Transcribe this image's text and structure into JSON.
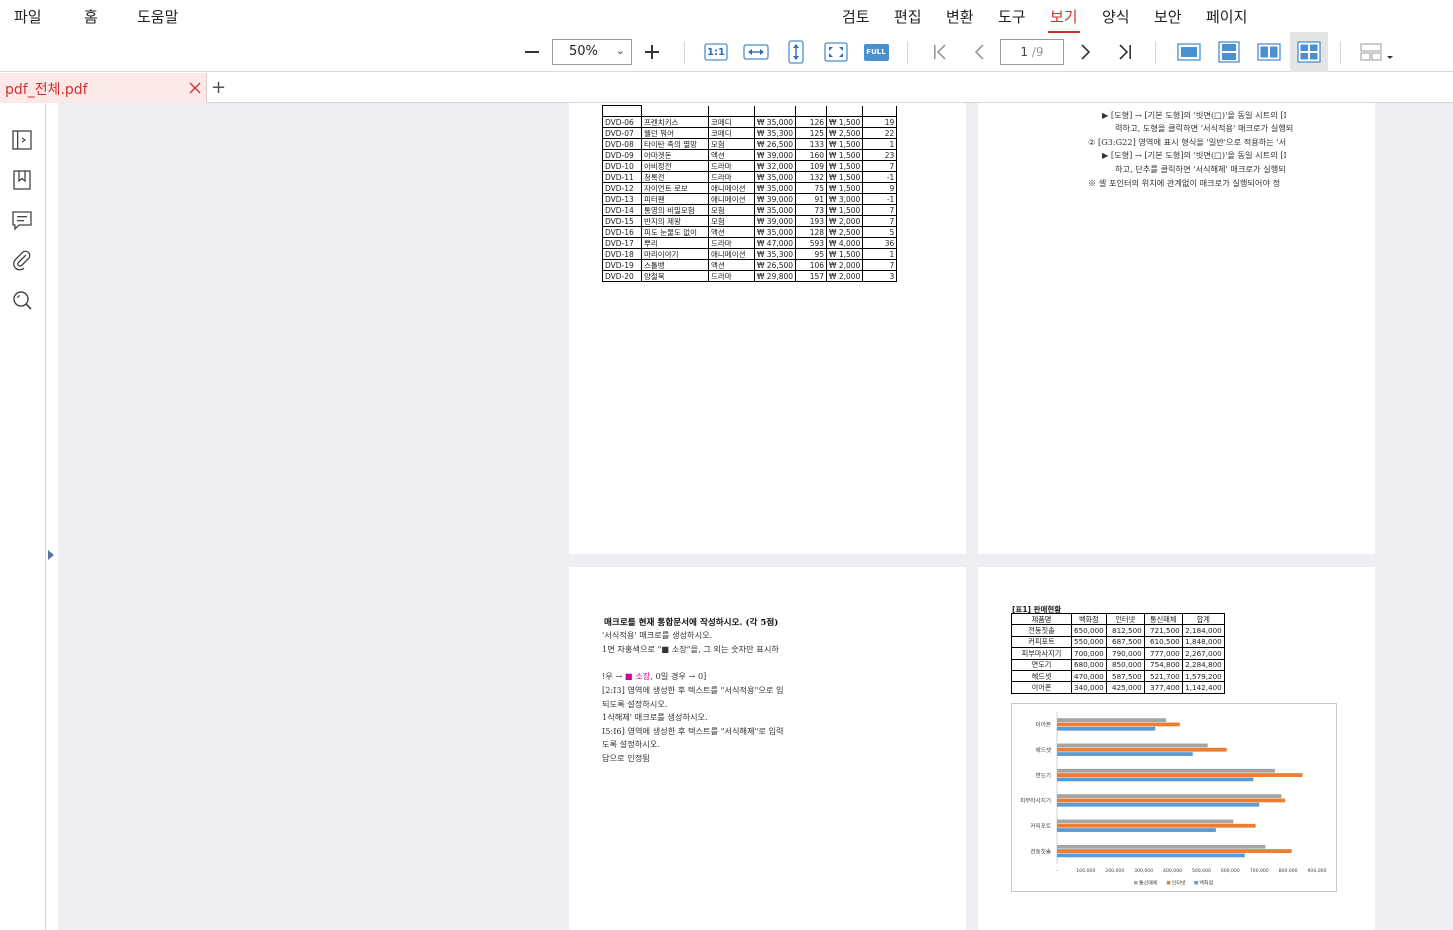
{
  "menu": {
    "left": [
      "파일",
      "홈",
      "도움말"
    ],
    "right": [
      "검토",
      "편집",
      "변환",
      "도구",
      "보기",
      "양식",
      "보안",
      "페이지"
    ],
    "active": "보기"
  },
  "toolbar": {
    "zoom": "50%",
    "page_current": "1",
    "page_total": "/9",
    "actual_size": "1:1",
    "full": "FULL"
  },
  "tab": {
    "title": "pdf_전체.pdf",
    "add": "+"
  },
  "colors": {
    "accent": "#d03030",
    "tab_bg": "#fde8e8",
    "viewer_bg": "#edeef1",
    "toolbar_blue": "#4a8fd0"
  },
  "dvd_table": {
    "rows": [
      [
        "DVD-06",
        "프렌치키스",
        "코메디",
        "₩ 35,000",
        "126",
        "₩ 1,500",
        "19"
      ],
      [
        "DVD-07",
        "웰던 뭐어",
        "코메디",
        "₩ 35,300",
        "125",
        "₩ 2,500",
        "22"
      ],
      [
        "DVD-08",
        "타이탄 족의 멸망",
        "모험",
        "₩ 26,500",
        "133",
        "₩ 1,500",
        "1"
      ],
      [
        "DVD-09",
        "아마겟돈",
        "액션",
        "₩ 39,000",
        "160",
        "₩ 1,500",
        "23"
      ],
      [
        "DVD-10",
        "아비정전",
        "드라마",
        "₩ 32,000",
        "109",
        "₩ 1,500",
        "7"
      ],
      [
        "DVD-11",
        "청록전",
        "드라마",
        "₩ 35,000",
        "132",
        "₩ 1,500",
        "-1"
      ],
      [
        "DVD-12",
        "자이언트 로보",
        "애니메이션",
        "₩ 35,000",
        "75",
        "₩ 1,500",
        "9"
      ],
      [
        "DVD-13",
        "피터팬",
        "애니메이션",
        "₩ 39,000",
        "91",
        "₩ 3,000",
        "-1"
      ],
      [
        "DVD-14",
        "통영의 비밀모험",
        "모험",
        "₩ 35,000",
        "73",
        "₩ 1,500",
        "7"
      ],
      [
        "DVD-15",
        "반지의 제왕",
        "모험",
        "₩ 39,000",
        "193",
        "₩ 2,000",
        "7"
      ],
      [
        "DVD-16",
        "피도 눈물도 없이",
        "액션",
        "₩ 35,000",
        "128",
        "₩ 2,500",
        "5"
      ],
      [
        "DVD-17",
        "뿌리",
        "드라마",
        "₩ 47,000",
        "593",
        "₩ 4,000",
        "36"
      ],
      [
        "DVD-18",
        "마리이야기",
        "애니메이션",
        "₩ 35,300",
        "95",
        "₩ 1,500",
        "1"
      ],
      [
        "DVD-19",
        "스톨뱅",
        "액션",
        "₩ 26,500",
        "106",
        "₩ 2,000",
        "7"
      ],
      [
        "DVD-20",
        "양철북",
        "드라마",
        "₩ 29,800",
        "157",
        "₩ 2,000",
        "3"
      ]
    ]
  },
  "page2_lines": [
    "▶ [도형] → [기본 도형]의 '빗면(□)'을 동일 시트의 [I",
    "력하고, 도형을 클릭하면 '서식적용' 매크로가 실행되",
    "② [G3:G22] 영역에 표시 형식을 '일반'으로 적용하는 '서",
    "▶ [도형] → [기본 도형]의 '빗면(□)'을 동일 시트의 [I",
    "하고, 단추를 클릭하면 '서식해제' 매크로가 실행되",
    "※ 셀 포인터의 위치에 관계없이 매크로가 실행되어야 정"
  ],
  "page3_lines": {
    "heading": "매크로를 현재 통합문서에 작성하시오. (각 5점)",
    "l1": "'서식적용' 매크로를 생성하시오.",
    "l2": "1면 자홍색으로 \"■ 소장\"을, 그 외는 숫자만 표시하",
    "l3a": "!우 → ",
    "l3b": "■ 소장",
    "l3c": ", 0일 경우 → 0]",
    "l4": "[2:I3] 영역에 생성한 후 텍스트를 \"서식적용\"으로 입",
    "l5": "되도록 설정하시오.",
    "l6": "1식해제' 매크로를 생성하시오.",
    "l7": "I5:I6] 영역에 생성한 후 텍스트를 \"서식해제\"로 입력",
    "l8": "도록 설정하시오.",
    "l9": "답으로 인정됨"
  },
  "sales_table": {
    "title": "[표1] 판매현황",
    "header": [
      "제품명",
      "백화점",
      "인터넷",
      "통신매체",
      "합계"
    ],
    "rows": [
      [
        "전동칫솔",
        "650,000",
        "812,500",
        "721,500",
        "2,184,000"
      ],
      [
        "커피포트",
        "550,000",
        "687,500",
        "610,500",
        "1,848,000"
      ],
      [
        "피부마사지기",
        "700,000",
        "790,000",
        "777,000",
        "2,267,000"
      ],
      [
        "면도기",
        "680,000",
        "850,000",
        "754,800",
        "2,284,800"
      ],
      [
        "헤드셋",
        "470,000",
        "587,500",
        "521,700",
        "1,579,200"
      ],
      [
        "이어폰",
        "340,000",
        "425,000",
        "377,400",
        "1,142,400"
      ]
    ]
  },
  "chart_data": {
    "type": "bar",
    "orientation": "horizontal",
    "categories": [
      "이어폰",
      "헤드셋",
      "면도기",
      "피부마사지기",
      "커피포트",
      "전동칫솔"
    ],
    "series": [
      {
        "name": "통신매체",
        "color": "#a5a5a5",
        "values": [
          377400,
          521700,
          754800,
          777000,
          610500,
          721500
        ]
      },
      {
        "name": "인터넷",
        "color": "#ed7d31",
        "values": [
          425000,
          587500,
          850000,
          790000,
          687500,
          812500
        ]
      },
      {
        "name": "백화점",
        "color": "#5b9bd5",
        "values": [
          340000,
          470000,
          680000,
          700000,
          550000,
          650000
        ]
      }
    ],
    "xlim": [
      0,
      900000
    ],
    "xticks": [
      "-",
      "100,000",
      "200,000",
      "300,000",
      "400,000",
      "500,000",
      "600,000",
      "700,000",
      "800,000",
      "900,000"
    ],
    "legend": "bottom",
    "grid": false
  }
}
